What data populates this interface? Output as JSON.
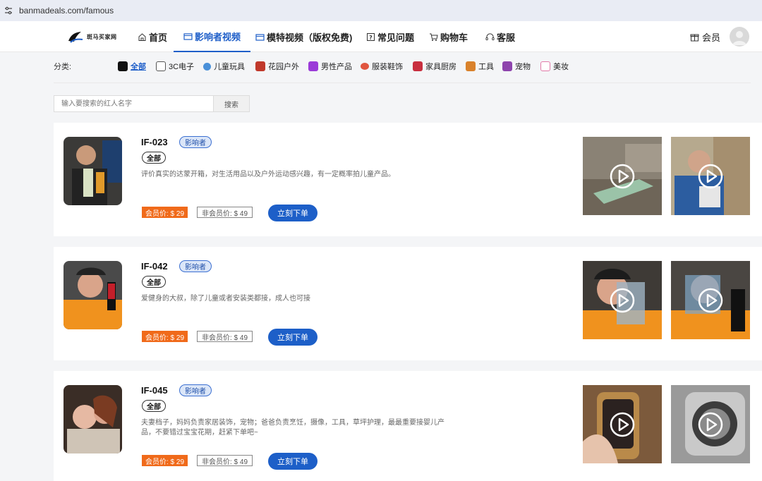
{
  "browser": {
    "url": "banmadeals.com/famous"
  },
  "header": {
    "logo_text": "斑马买家网",
    "nav": [
      {
        "label": "首页",
        "icon": "home-icon"
      },
      {
        "label": "影响者视频",
        "icon": "video-icon"
      },
      {
        "label": "模特视频（版权免费)",
        "icon": "video-icon"
      },
      {
        "label": "常见问题",
        "icon": "question-icon"
      },
      {
        "label": "购物车",
        "icon": "cart-icon"
      },
      {
        "label": "客服",
        "icon": "headset-icon"
      }
    ],
    "member_label": "会员"
  },
  "categories": {
    "label": "分类:",
    "items": [
      {
        "label": "全部",
        "active": true,
        "color": "#111111"
      },
      {
        "label": "3C电子",
        "color": "#555555"
      },
      {
        "label": "儿童玩具",
        "color": "#4a90d9"
      },
      {
        "label": "花园户外",
        "color": "#c0392b"
      },
      {
        "label": "男性产品",
        "color": "#9b3bd8"
      },
      {
        "label": "服装鞋饰",
        "color": "#e0553f"
      },
      {
        "label": "家具厨房",
        "color": "#c82f3f"
      },
      {
        "label": "工具",
        "color": "#d9822b"
      },
      {
        "label": "宠物",
        "color": "#8e44ad"
      },
      {
        "label": "美妆",
        "color": "#e27aa8"
      }
    ]
  },
  "search": {
    "placeholder": "输入要搜索的红人名字",
    "button_label": "搜索"
  },
  "cards": [
    {
      "id": "IF-023",
      "badge": "影响者",
      "tag": "全部",
      "desc": "评价真实的达蒙开箱，对生活用品以及户外运动感兴趣，有一定概率拍儿童产品。",
      "member_price": "会员价: $ 29",
      "nonmember_price": "非会员价: $ 49",
      "order_label": "立刻下单"
    },
    {
      "id": "IF-042",
      "badge": "影响者",
      "tag": "全部",
      "desc": "爱健身的大叔，除了儿童或者安装类都接，成人也可接",
      "member_price": "会员价: $ 29",
      "nonmember_price": "非会员价: $ 49",
      "order_label": "立刻下单"
    },
    {
      "id": "IF-045",
      "badge": "影响者",
      "tag": "全部",
      "desc": "夫妻档子，妈妈负责家居装饰，宠物；爸爸负责烹饪，摄像，工具，草坪护理，最最重要接婴儿产品，不要错过宝宝花期，赶紧下单吧~",
      "member_price": "会员价: $ 29",
      "nonmember_price": "非会员价: $ 49",
      "order_label": "立刻下单"
    }
  ],
  "colors": {
    "accent": "#1f5fc9",
    "member_price_bg": "#f06a1a",
    "order_button": "#1d5fc8"
  }
}
